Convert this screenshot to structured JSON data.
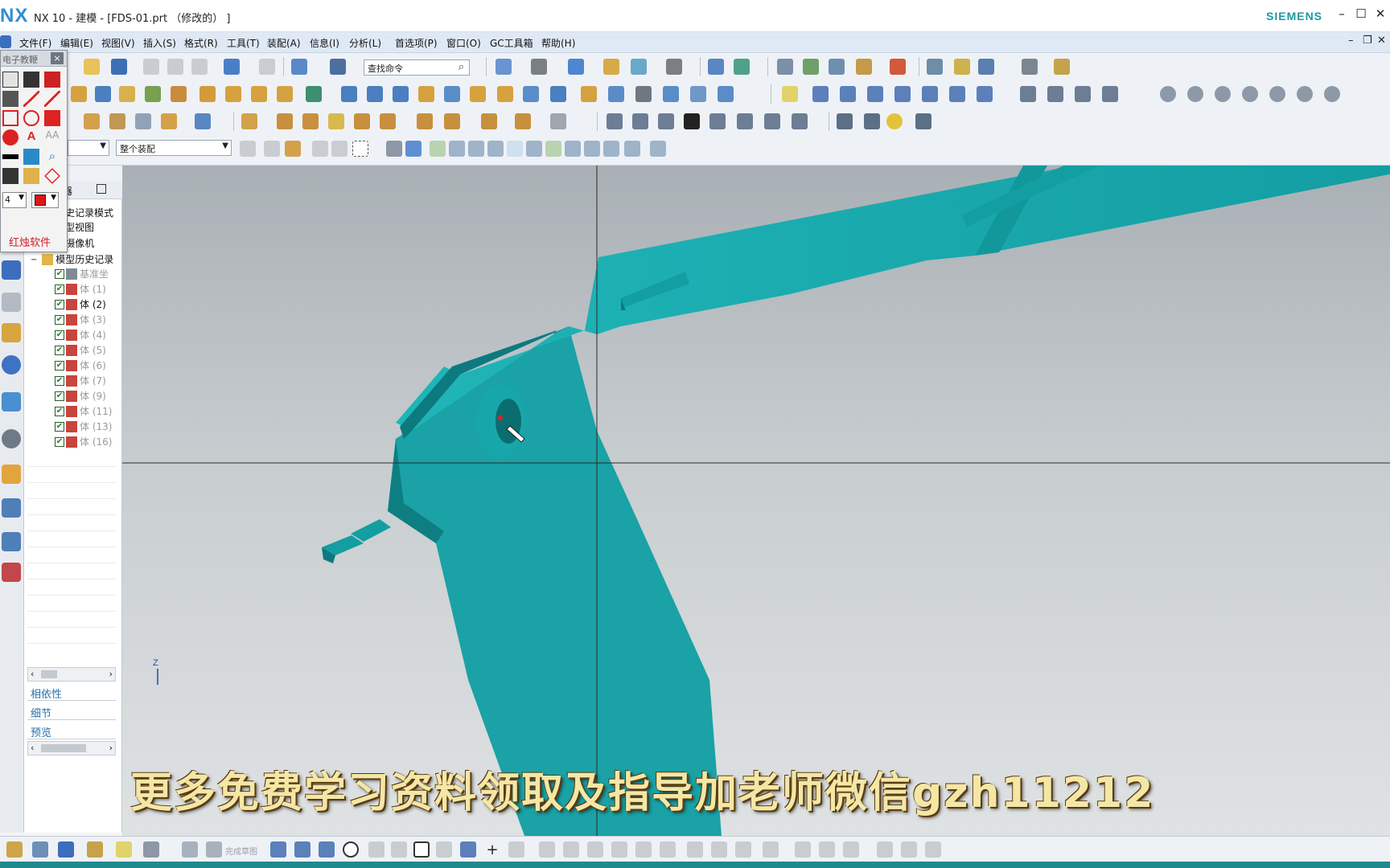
{
  "window": {
    "logo": "NX",
    "title": "NX 10 - 建模 - [FDS-01.prt （修改的） ]",
    "brand": "SIEMENS",
    "controls": [
      "–",
      "☐",
      "✕"
    ]
  },
  "menubar": {
    "items": [
      "文件(F)",
      "编辑(E)",
      "视图(V)",
      "插入(S)",
      "格式(R)",
      "工具(T)",
      "装配(A)",
      "信息(I)",
      "分析(L)",
      "首选项(P)",
      "窗口(O)",
      "GC工具箱",
      "帮助(H)"
    ],
    "mdi_controls": [
      "–",
      "❐",
      "✕"
    ]
  },
  "toolbar": {
    "search_placeholder": "查找命令",
    "filter_combo_1": "",
    "filter_combo_2": "整个装配"
  },
  "palette": {
    "title": "电子教鞭",
    "close": "×",
    "line_width": "4",
    "brand_text": "红烛软件",
    "aa_label": "AA"
  },
  "navigator": {
    "header": "器",
    "nodes": [
      {
        "label": "史记录模式",
        "grey": false
      },
      {
        "label": "型视图",
        "grey": false
      },
      {
        "label": "摄像机",
        "grey": false
      },
      {
        "label": "模型历史记录",
        "grey": false
      },
      {
        "label": "基准坐",
        "grey": true
      },
      {
        "label": "体 (1)",
        "grey": true
      },
      {
        "label": "体 (2)",
        "grey": false
      },
      {
        "label": "体 (3)",
        "grey": true
      },
      {
        "label": "体 (4)",
        "grey": true
      },
      {
        "label": "体 (5)",
        "grey": true
      },
      {
        "label": "体 (6)",
        "grey": true
      },
      {
        "label": "体 (7)",
        "grey": true
      },
      {
        "label": "体 (9)",
        "grey": true
      },
      {
        "label": "体 (11)",
        "grey": true
      },
      {
        "label": "体 (13)",
        "grey": true
      },
      {
        "label": "体 (16)",
        "grey": true
      }
    ],
    "panels": [
      "相依性",
      "细节",
      "预览"
    ]
  },
  "bottombar": {
    "sketch_label": "完成草图"
  },
  "viewport": {
    "axis_label": "Z",
    "model_color": "#1aa2a6"
  },
  "overlay": {
    "watermark": "更多免费学习资料领取及指导加老师微信gzh11212"
  }
}
